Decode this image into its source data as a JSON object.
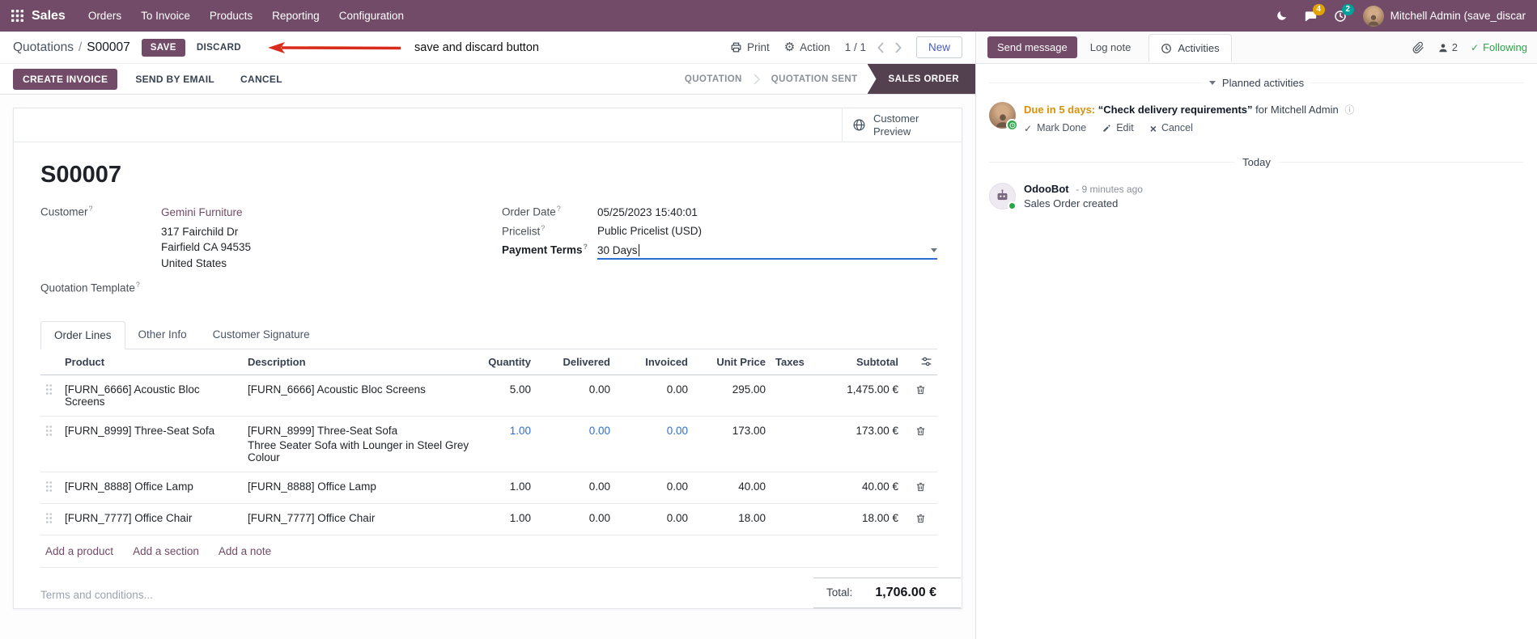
{
  "topbar": {
    "app_name": "Sales",
    "menus": [
      "Orders",
      "To Invoice",
      "Products",
      "Reporting",
      "Configuration"
    ],
    "messages_badge": "4",
    "activities_badge": "2",
    "user_name": "Mitchell Admin (save_discar"
  },
  "control_panel": {
    "breadcrumb_parent": "Quotations",
    "breadcrumb_separator": "/",
    "breadcrumb_current": "S00007",
    "save_label": "SAVE",
    "discard_label": "DISCARD",
    "annotation_text": "save and discard button",
    "print_label": "Print",
    "action_label": "Action",
    "pager_text": "1 / 1",
    "new_label": "New"
  },
  "statusbar": {
    "create_invoice": "CREATE INVOICE",
    "send_by_email": "SEND BY EMAIL",
    "cancel": "CANCEL",
    "stages": [
      "QUOTATION",
      "QUOTATION SENT",
      "SALES ORDER"
    ],
    "active_stage": "SALES ORDER"
  },
  "form": {
    "customer_preview": "Customer Preview",
    "title": "S00007",
    "help_marker": "?",
    "customer": {
      "label": "Customer",
      "name": "Gemini Furniture",
      "address": [
        "317 Fairchild Dr",
        "Fairfield CA 94535",
        "United States"
      ]
    },
    "quotation_template_label": "Quotation Template",
    "order_date": {
      "label": "Order Date",
      "value": "05/25/2023 15:40:01"
    },
    "pricelist": {
      "label": "Pricelist",
      "value": "Public Pricelist (USD)"
    },
    "payment_terms": {
      "label": "Payment Terms",
      "value": "30 Days"
    },
    "tabs": [
      "Order Lines",
      "Other Info",
      "Customer Signature"
    ],
    "table": {
      "headers": [
        "Product",
        "Description",
        "Quantity",
        "Delivered",
        "Invoiced",
        "Unit Price",
        "Taxes",
        "Subtotal"
      ],
      "rows": [
        {
          "product": "[FURN_6666] Acoustic Bloc Screens",
          "description": "[FURN_6666] Acoustic Bloc Screens",
          "description2": "",
          "quantity": "5.00",
          "delivered": "0.00",
          "invoiced": "0.00",
          "unit_price": "295.00",
          "taxes": "",
          "subtotal": "1,475.00 €"
        },
        {
          "product": "[FURN_8999] Three-Seat Sofa",
          "description": "[FURN_8999] Three-Seat Sofa",
          "description2": "Three Seater Sofa with Lounger in Steel Grey Colour",
          "quantity": "1.00",
          "delivered": "0.00",
          "invoiced": "0.00",
          "unit_price": "173.00",
          "taxes": "",
          "subtotal": "173.00 €"
        },
        {
          "product": "[FURN_8888] Office Lamp",
          "description": "[FURN_8888] Office Lamp",
          "description2": "",
          "quantity": "1.00",
          "delivered": "0.00",
          "invoiced": "0.00",
          "unit_price": "40.00",
          "taxes": "",
          "subtotal": "40.00 €"
        },
        {
          "product": "[FURN_7777] Office Chair",
          "description": "[FURN_7777] Office Chair",
          "description2": "",
          "quantity": "1.00",
          "delivered": "0.00",
          "invoiced": "0.00",
          "unit_price": "18.00",
          "taxes": "",
          "subtotal": "18.00 €"
        }
      ],
      "links": [
        "Add a product",
        "Add a section",
        "Add a note"
      ]
    },
    "terms_placeholder": "Terms and conditions...",
    "total_label": "Total:",
    "total_value": "1,706.00 €"
  },
  "chatter": {
    "send_message": "Send message",
    "log_note": "Log note",
    "activities": "Activities",
    "followers_count": "2",
    "following": "Following",
    "planned_activities": "Planned activities",
    "activity": {
      "due": "Due in 5 days:",
      "summary": "“Check delivery requirements”",
      "assignee": "for Mitchell Admin",
      "mark_done": "Mark Done",
      "edit": "Edit",
      "cancel": "Cancel"
    },
    "day_divider": "Today",
    "message": {
      "author": "OdooBot",
      "time": "- 9 minutes ago",
      "body": "Sales Order created"
    }
  }
}
